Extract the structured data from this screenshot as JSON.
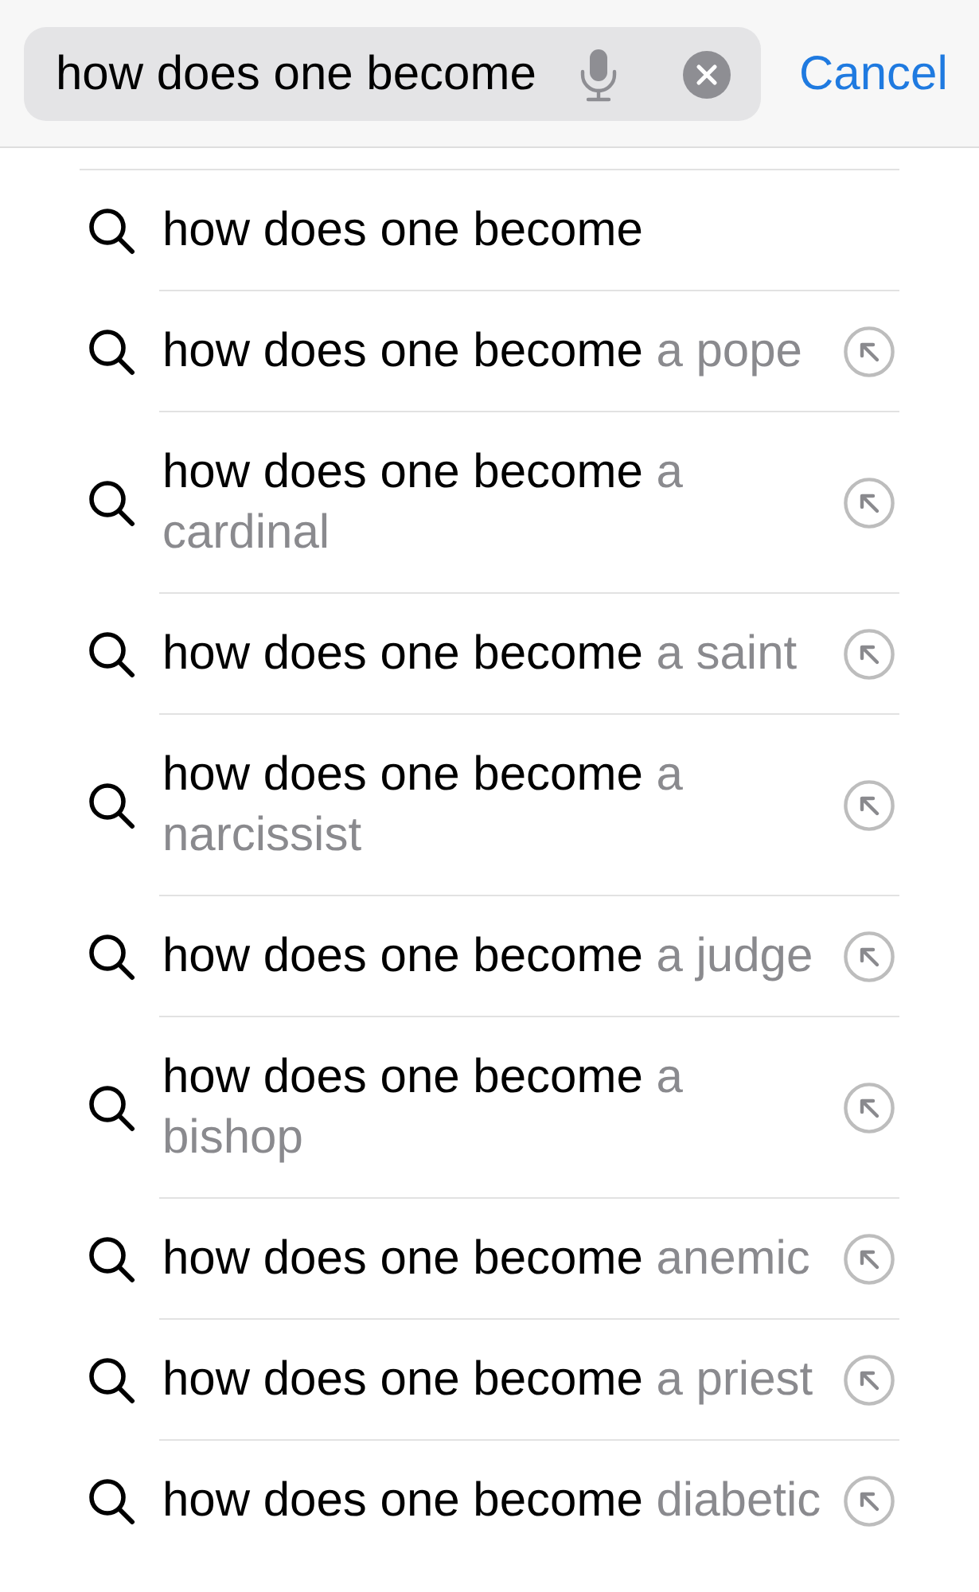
{
  "search_bar": {
    "value": "how does one become",
    "cancel": "Cancel"
  },
  "suggestions": [
    {
      "query": "how does one become"
    },
    {
      "query": "how does one become",
      "completion": "a pope"
    },
    {
      "query": "how does one become",
      "completion": "a cardinal"
    },
    {
      "query": "how does one become",
      "completion": "a saint"
    },
    {
      "query": "how does one become",
      "completion": "a narcissist"
    },
    {
      "query": "how does one become",
      "completion": "a judge"
    },
    {
      "query": "how does one become",
      "completion": "a bishop"
    },
    {
      "query": "how does one become",
      "completion": "anemic"
    },
    {
      "query": "how does one become",
      "completion": "a priest"
    },
    {
      "query": "how does one become",
      "completion": "diabetic"
    }
  ]
}
